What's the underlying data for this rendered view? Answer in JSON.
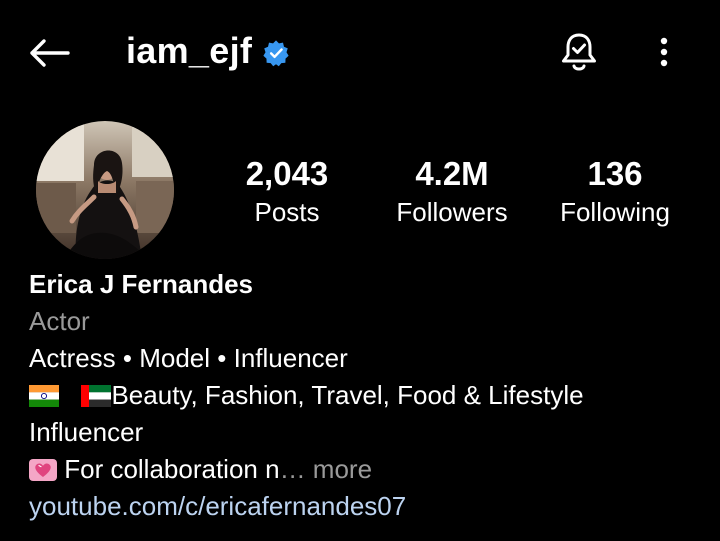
{
  "header": {
    "username": "iam_ejf",
    "back_icon": "arrow-left-icon",
    "verified_icon": "verified-badge-icon",
    "bell_icon": "notification-bell-icon",
    "more_icon": "more-vertical-icon",
    "verified_color": "#3897f0"
  },
  "stats": {
    "posts": {
      "value": "2,043",
      "label": "Posts"
    },
    "followers": {
      "value": "4.2M",
      "label": "Followers"
    },
    "following": {
      "value": "136",
      "label": "Following"
    }
  },
  "profile": {
    "avatar_icon": "profile-photo",
    "name": "Erica J Fernandes",
    "category": "Actor",
    "bio_line1": "Actress • Model • Influencer",
    "bio_line2_text": "Beauty, Fashion, Travel, Food & Lifestyle",
    "bio_line2_icons": [
      "india-flag-icon",
      "uae-flag-icon"
    ],
    "bio_line3": "Influencer",
    "bio_line4_text": " For collaboration n",
    "bio_line4_icon": "pink-heart-icon",
    "more_label": "… more",
    "link": "youtube.com/c/ericafernandes07",
    "link_color": "#bcd3f0",
    "muted_color": "#9a9a9a"
  }
}
